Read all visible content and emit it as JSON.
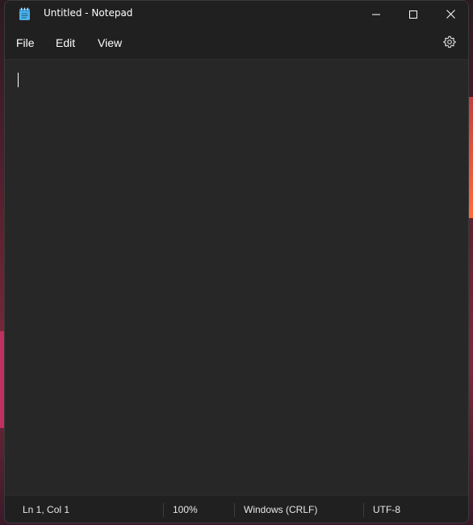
{
  "window": {
    "title": "Untitled - Notepad",
    "icon": "notepad-icon",
    "controls": [
      "minimize-icon",
      "maximize-icon",
      "close-icon"
    ]
  },
  "menu": {
    "items": [
      "File",
      "Edit",
      "View"
    ],
    "settings_icon": "gear-icon"
  },
  "editor": {
    "content": ""
  },
  "status": {
    "position": "Ln 1, Col 1",
    "zoom": "100%",
    "line_ending": "Windows (CRLF)",
    "encoding": "UTF-8"
  }
}
